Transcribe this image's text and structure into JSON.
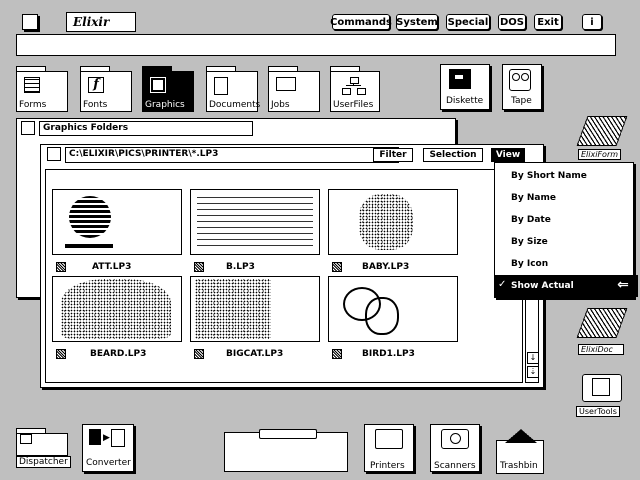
{
  "app": {
    "logo": "Elixir"
  },
  "menubar": {
    "commands": "Commands",
    "system": "System",
    "special": "Special",
    "dos": "DOS",
    "exit": "Exit",
    "info": "i"
  },
  "folders": [
    {
      "label": "Forms"
    },
    {
      "label": "Fonts"
    },
    {
      "label": "Graphics"
    },
    {
      "label": "Documents"
    },
    {
      "label": "Jobs"
    },
    {
      "label": "UserFiles"
    }
  ],
  "drives": {
    "diskette": "Diskette",
    "tape": "Tape"
  },
  "window": {
    "title": "Graphics Folders",
    "path": "C:\\ELIXIR\\PICS\\PRINTER\\*.LP3",
    "filter": "Filter",
    "selection": "Selection",
    "view": "View"
  },
  "files": [
    {
      "name": "ATT.LP3"
    },
    {
      "name": "B.LP3"
    },
    {
      "name": "BABY.LP3"
    },
    {
      "name": "BEARD.LP3"
    },
    {
      "name": "BIGCAT.LP3"
    },
    {
      "name": "BIRD1.LP3"
    }
  ],
  "view_menu": {
    "items": [
      "By Short Name",
      "By Name",
      "By Date",
      "By Size",
      "By Icon",
      "Show Actual"
    ],
    "selected": "Show Actual",
    "check": "✓"
  },
  "right_icons": {
    "elixirform": "ElixiForm",
    "elixirdoc": "ElixiDoc",
    "usertools": "UserTools"
  },
  "bottom": {
    "dispatcher": "Dispatcher",
    "converter": "Converter",
    "printers": "Printers",
    "scanners": "Scanners",
    "trashbin": "Trashbin"
  }
}
